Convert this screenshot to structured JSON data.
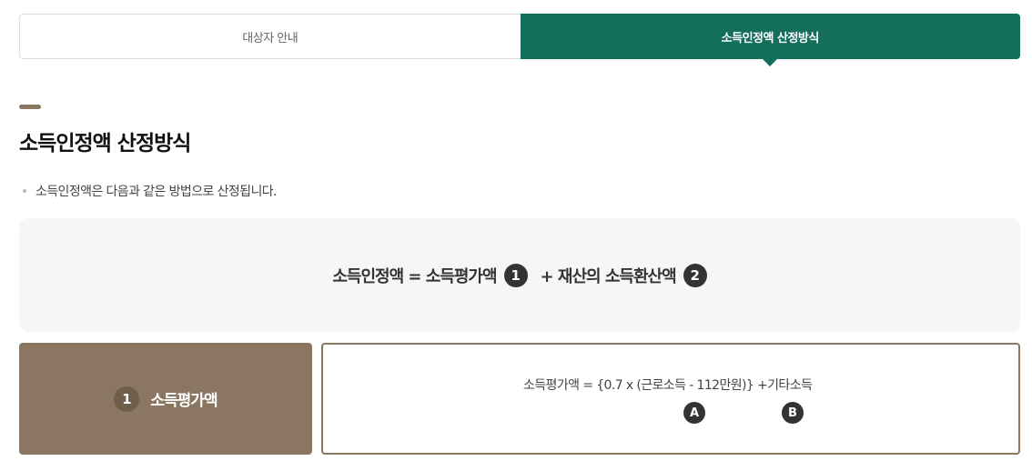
{
  "tabs": [
    {
      "label": "대상자 안내",
      "active": false
    },
    {
      "label": "소득인정액 산정방식",
      "active": true
    }
  ],
  "colors": {
    "accent_green": "#136e5c",
    "accent_brown": "#8b7761"
  },
  "section": {
    "title": "소득인정액 산정방식",
    "bullet": "소득인정액은 다음과 같은 방법으로 산정됩니다."
  },
  "formula": {
    "part1": "소득인정액 = 소득평가액",
    "badge1": "1",
    "part2": "+ 재산의 소득환산액",
    "badge2": "2"
  },
  "card": {
    "number": "1",
    "label": "소득평가액",
    "formula_text": "소득평가액 = {0.7 x (근로소득 - 112만원)} +기타소득",
    "badge_a": "A",
    "badge_b": "B"
  }
}
